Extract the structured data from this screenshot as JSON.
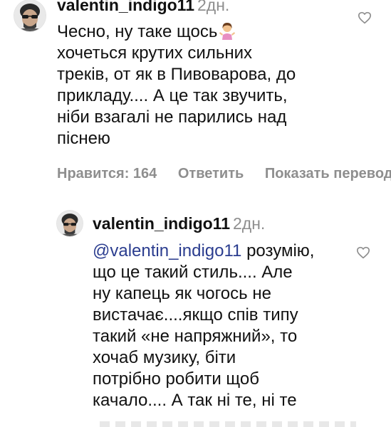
{
  "comments": [
    {
      "username": "valentin_indigo11",
      "time": "2дн.",
      "lines": [
        "Чесно, ну таке щось",
        "хочеться крутих сильних",
        "треків, от як в Пивоварова, до",
        "прикладу.... А це так звучить,",
        "ніби взагалі не парились над",
        "піснею"
      ],
      "emoji": "woman-shrugging-emoji",
      "actions": {
        "likes": "Нравится: 164",
        "reply": "Ответить",
        "show_more": "Показать переводы"
      }
    },
    {
      "username": "valentin_indigo11",
      "time": "2дн.",
      "mention": "@valentin_indigo11",
      "first_line_rest": " розумію,",
      "lines": [
        "що це такий стиль.... Але",
        "ну капець як чогось не",
        "вистачає....якщо спів типу",
        "такий «не напряжний», то",
        "хочаб музику, біти",
        "потрібно робити щоб",
        "качало.... А так ні те, ні те"
      ]
    }
  ],
  "icons": {
    "avatar": "avatar-sunglasses-icon",
    "like": "heart-outline-icon"
  },
  "colors": {
    "muted": "#8e8e8e",
    "mention": "#2b3d8f",
    "text": "#111111"
  }
}
